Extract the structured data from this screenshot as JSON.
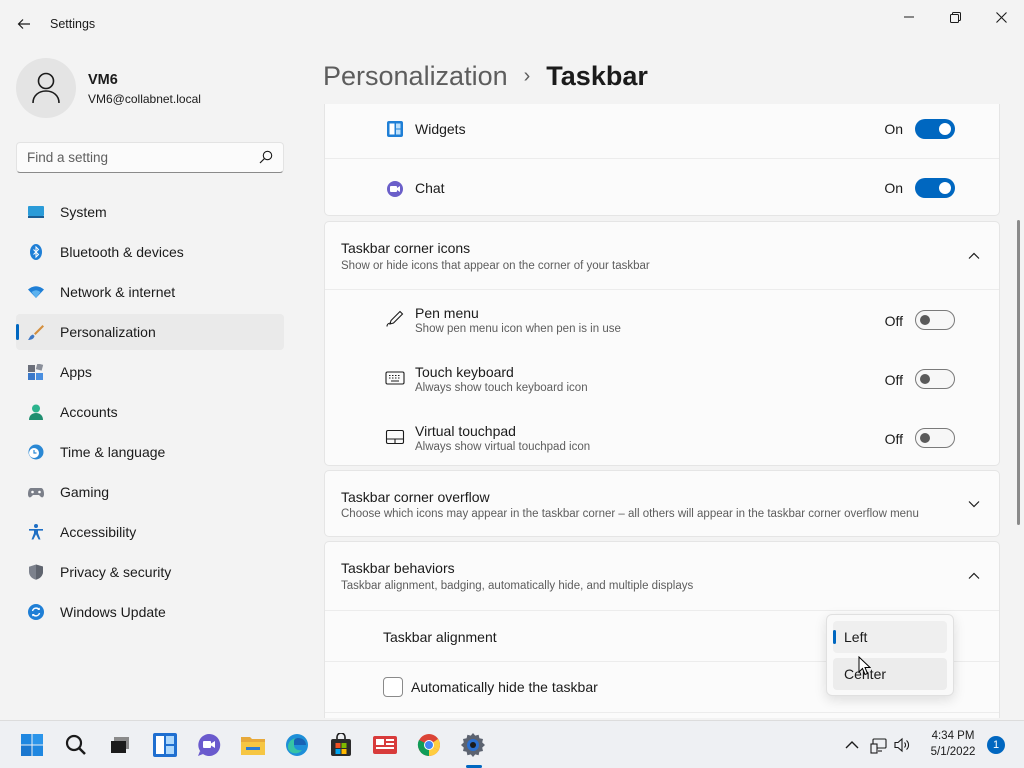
{
  "window": {
    "title": "Settings"
  },
  "profile": {
    "name": "VM6",
    "email": "VM6@collabnet.local"
  },
  "search": {
    "placeholder": "Find a setting"
  },
  "sidebar": {
    "items": [
      {
        "label": "System",
        "icon": "system-icon"
      },
      {
        "label": "Bluetooth & devices",
        "icon": "bluetooth-icon"
      },
      {
        "label": "Network & internet",
        "icon": "wifi-icon"
      },
      {
        "label": "Personalization",
        "icon": "brush-icon",
        "selected": true
      },
      {
        "label": "Apps",
        "icon": "apps-icon"
      },
      {
        "label": "Accounts",
        "icon": "accounts-icon"
      },
      {
        "label": "Time & language",
        "icon": "globe-clock-icon"
      },
      {
        "label": "Gaming",
        "icon": "gamepad-icon"
      },
      {
        "label": "Accessibility",
        "icon": "accessibility-icon"
      },
      {
        "label": "Privacy & security",
        "icon": "shield-icon"
      },
      {
        "label": "Windows Update",
        "icon": "update-icon"
      }
    ]
  },
  "breadcrumb": {
    "parent": "Personalization",
    "separator": "›",
    "current": "Taskbar"
  },
  "taskbar_items": {
    "widgets": {
      "label": "Widgets",
      "state": "On"
    },
    "chat": {
      "label": "Chat",
      "state": "On"
    }
  },
  "corner_icons": {
    "title": "Taskbar corner icons",
    "subtitle": "Show or hide icons that appear on the corner of your taskbar",
    "items": {
      "pen": {
        "label": "Pen menu",
        "sub": "Show pen menu icon when pen is in use",
        "state": "Off"
      },
      "keyboard": {
        "label": "Touch keyboard",
        "sub": "Always show touch keyboard icon",
        "state": "Off"
      },
      "touchpad": {
        "label": "Virtual touchpad",
        "sub": "Always show virtual touchpad icon",
        "state": "Off"
      }
    }
  },
  "corner_overflow": {
    "title": "Taskbar corner overflow",
    "subtitle": "Choose which icons may appear in the taskbar corner – all others will appear in the taskbar corner overflow menu"
  },
  "behaviors": {
    "title": "Taskbar behaviors",
    "subtitle": "Taskbar alignment, badging, automatically hide, and multiple displays",
    "alignment_label": "Taskbar alignment",
    "autohide_label": "Automatically hide the taskbar"
  },
  "alignment_dropdown": {
    "options": [
      "Left",
      "Center"
    ],
    "selected": "Left"
  },
  "clock": {
    "time": "4:34 PM",
    "date": "5/1/2022"
  },
  "notifications": {
    "count": "1"
  },
  "colors": {
    "accent": "#0067c0"
  }
}
